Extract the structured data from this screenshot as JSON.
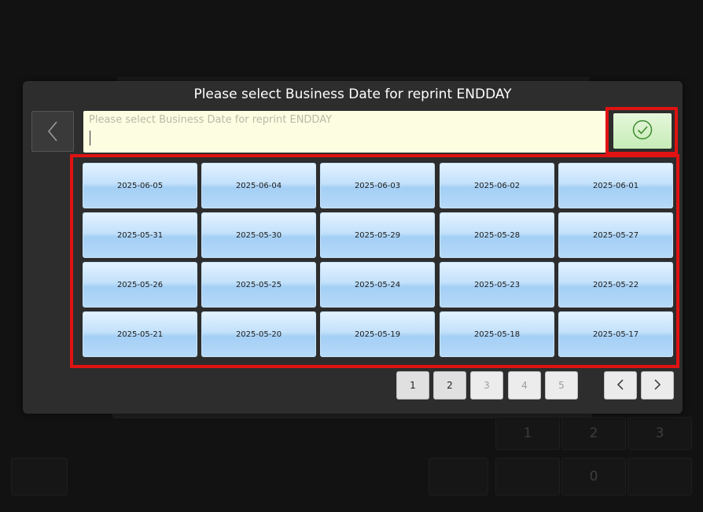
{
  "dialog": {
    "title": "Please select Business Date for reprint ENDDAY",
    "input_placeholder": "Please select Business Date for reprint ENDDAY",
    "input_value": ""
  },
  "icons": {
    "back": "chevron-left-icon",
    "confirm": "check-circle-icon",
    "prev_page": "chevron-left-icon",
    "next_page": "chevron-right-icon"
  },
  "dates": [
    "2025-06-05",
    "2025-06-04",
    "2025-06-03",
    "2025-06-02",
    "2025-06-01",
    "2025-05-31",
    "2025-05-30",
    "2025-05-29",
    "2025-05-28",
    "2025-05-27",
    "2025-05-26",
    "2025-05-25",
    "2025-05-24",
    "2025-05-23",
    "2025-05-22",
    "2025-05-21",
    "2025-05-20",
    "2025-05-19",
    "2025-05-18",
    "2025-05-17"
  ],
  "pagination": {
    "pages": [
      "1",
      "2",
      "3",
      "4",
      "5"
    ],
    "active_pages": [
      "1",
      "2"
    ]
  },
  "background_keys": [
    "1",
    "2",
    "3",
    "0"
  ],
  "colors": {
    "highlight": "#e01212",
    "confirm_check": "#3c8c2e",
    "input_bg": "#fdfde2"
  }
}
